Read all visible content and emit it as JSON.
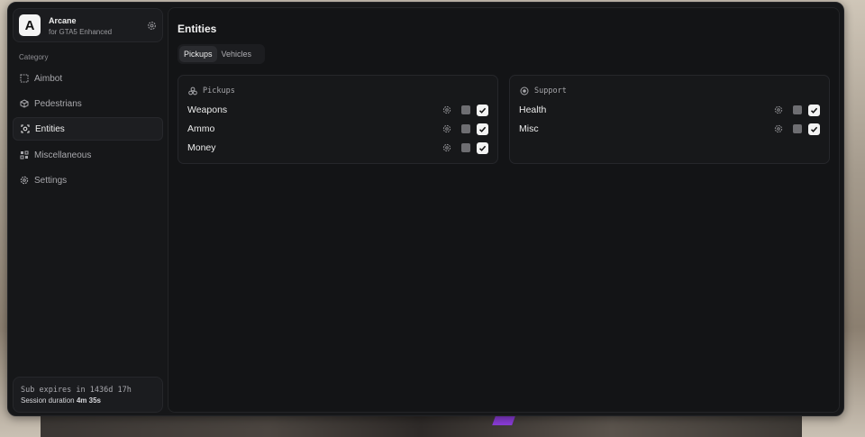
{
  "app": {
    "logo_letter": "A",
    "name": "Arcane",
    "subtitle": "for GTA5 Enhanced",
    "settings_icon": "gear-icon"
  },
  "sidebar": {
    "category_label": "Category",
    "items": [
      {
        "label": "Aimbot",
        "icon": "crosshair-dots-icon",
        "active": false
      },
      {
        "label": "Pedestrians",
        "icon": "cube-icon",
        "active": false
      },
      {
        "label": "Entities",
        "icon": "target-icon",
        "active": true
      },
      {
        "label": "Miscellaneous",
        "icon": "grid-icon",
        "active": false
      },
      {
        "label": "Settings",
        "icon": "gear-icon",
        "active": false
      }
    ],
    "subscription": {
      "expires_text": "Sub expires in 1436d 17h",
      "session_label": "Session duration",
      "session_value": "4m 35s"
    }
  },
  "main": {
    "title": "Entities",
    "tabs": [
      {
        "label": "Pickups",
        "active": true
      },
      {
        "label": "Vehicles",
        "active": false
      }
    ],
    "groups": [
      {
        "title": "Pickups",
        "icon": "pickups-icon",
        "rows": [
          {
            "label": "Weapons",
            "enabled": true
          },
          {
            "label": "Ammo",
            "enabled": true
          },
          {
            "label": "Money",
            "enabled": true
          }
        ]
      },
      {
        "title": "Support",
        "icon": "support-icon",
        "rows": [
          {
            "label": "Health",
            "enabled": true
          },
          {
            "label": "Misc",
            "enabled": true
          }
        ]
      }
    ]
  },
  "colors": {
    "window_bg": "#161719",
    "panel_bg": "#131416",
    "checkbox_on": "#f3f3f3",
    "color_swatch": "#6e6e72"
  }
}
